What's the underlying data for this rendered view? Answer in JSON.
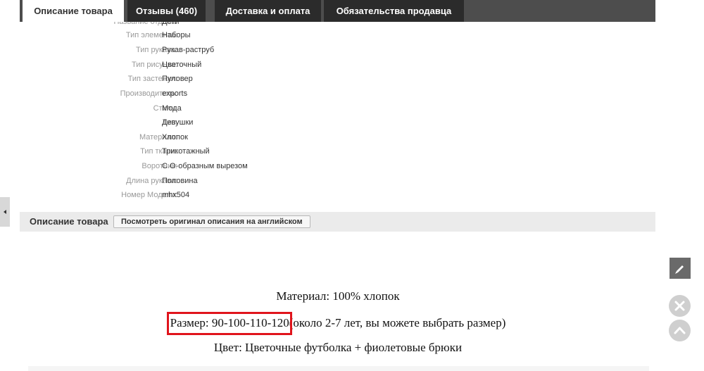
{
  "tabs": [
    {
      "label": "Описание товара",
      "active": true
    },
    {
      "label": "Отзывы (460)"
    },
    {
      "label": "Доставка и оплата"
    },
    {
      "label": "Обязательства продавца"
    }
  ],
  "properties": [
    {
      "label": "Название отдела:",
      "value": "Дети"
    },
    {
      "label": "Тип элемента:",
      "value": "Наборы"
    },
    {
      "label": "Тип рукава:",
      "value": "Рукав-раструб"
    },
    {
      "label": "Тип рисунка:",
      "value": "Цветочный"
    },
    {
      "label": "Тип застежки:",
      "value": "Пуловер"
    },
    {
      "label": "Производитель:",
      "value": "exports"
    },
    {
      "label": "Стиль:",
      "value": "Мода"
    },
    {
      "label": "Тип:",
      "value": "Девушки"
    },
    {
      "label": "Материал:",
      "value": "Хлопок"
    },
    {
      "label": "Тип ткани:",
      "value": "Трикотажный"
    },
    {
      "label": "Воротник:",
      "value": "С О-образным вырезом"
    },
    {
      "label": "Длина рукава:",
      "value": "Половина"
    },
    {
      "label": "Номер Модели:",
      "value": "mhx504"
    }
  ],
  "description_bar": {
    "title": "Описание товара",
    "original_button": "Посмотреть оригинал описания на английском"
  },
  "description": {
    "material": "Материал: 100% хлопок",
    "size_highlight": "Размер: 90-100-110-120",
    "size_rest": "(около 2-7 лет, вы можете выбрать размер)",
    "color": "Цвет: Цветочные футболка + фиолетовые брюки"
  },
  "colors": {
    "tab_bar": "#4d4d4d",
    "tab_inactive": "#2b2b2b",
    "highlight_border": "#e0141c"
  },
  "icons": {
    "side": "caret-left-icon",
    "edit": "pencil-icon",
    "close": "close-icon",
    "up": "chevron-up-icon"
  }
}
